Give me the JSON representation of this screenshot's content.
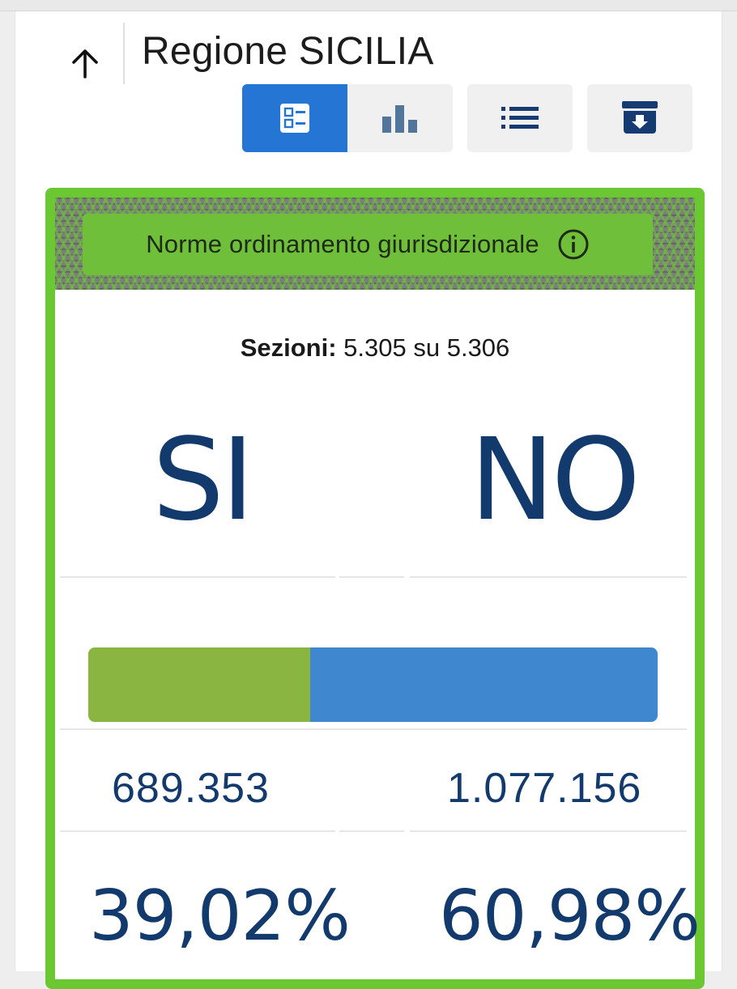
{
  "header": {
    "title": "Regione SICILIA"
  },
  "toolbar": {
    "buttons": [
      {
        "icon": "summary-list-icon",
        "active": true
      },
      {
        "icon": "bar-chart-icon",
        "active": false
      },
      {
        "icon": "list-icon",
        "active": false
      },
      {
        "icon": "download-archive-icon",
        "active": false
      }
    ]
  },
  "card": {
    "title": "Norme ordinamento giurisdizionale",
    "accent_color": "#6bc832",
    "sezioni_label": "Sezioni:",
    "sezioni_value": "5.305 su 5.306",
    "si": {
      "label": "SI",
      "votes": "689.353",
      "percent": "39,02%",
      "share": 0.3902,
      "color": "#8ab540"
    },
    "no": {
      "label": "NO",
      "votes": "1.077.156",
      "percent": "60,98%",
      "share": 0.6098,
      "color": "#3f88cf"
    }
  }
}
